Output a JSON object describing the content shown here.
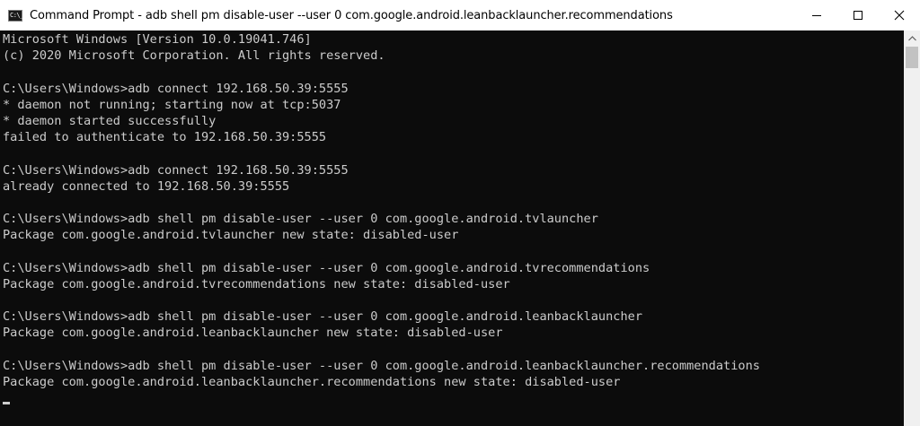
{
  "window": {
    "title": "Command Prompt - adb  shell pm disable-user --user 0 com.google.android.leanbacklauncher.recommendations",
    "icon_glyph": "C:\\_",
    "controls": [
      "minimize-icon",
      "maximize-icon",
      "close-icon"
    ]
  },
  "console": {
    "lines": [
      "Microsoft Windows [Version 10.0.19041.746]",
      "(c) 2020 Microsoft Corporation. All rights reserved.",
      "",
      "C:\\Users\\Windows>adb connect 192.168.50.39:5555",
      "* daemon not running; starting now at tcp:5037",
      "* daemon started successfully",
      "failed to authenticate to 192.168.50.39:5555",
      "",
      "C:\\Users\\Windows>adb connect 192.168.50.39:5555",
      "already connected to 192.168.50.39:5555",
      "",
      "C:\\Users\\Windows>adb shell pm disable-user --user 0 com.google.android.tvlauncher",
      "Package com.google.android.tvlauncher new state: disabled-user",
      "",
      "C:\\Users\\Windows>adb shell pm disable-user --user 0 com.google.android.tvrecommendations",
      "Package com.google.android.tvrecommendations new state: disabled-user",
      "",
      "C:\\Users\\Windows>adb shell pm disable-user --user 0 com.google.android.leanbacklauncher",
      "Package com.google.android.leanbacklauncher new state: disabled-user",
      "",
      "C:\\Users\\Windows>adb shell pm disable-user --user 0 com.google.android.leanbacklauncher.recommendations",
      "Package com.google.android.leanbacklauncher.recommendations new state: disabled-user"
    ]
  },
  "colors": {
    "console_bg": "#0c0c0c",
    "console_text": "#cccccc",
    "titlebar_bg": "#ffffff"
  }
}
